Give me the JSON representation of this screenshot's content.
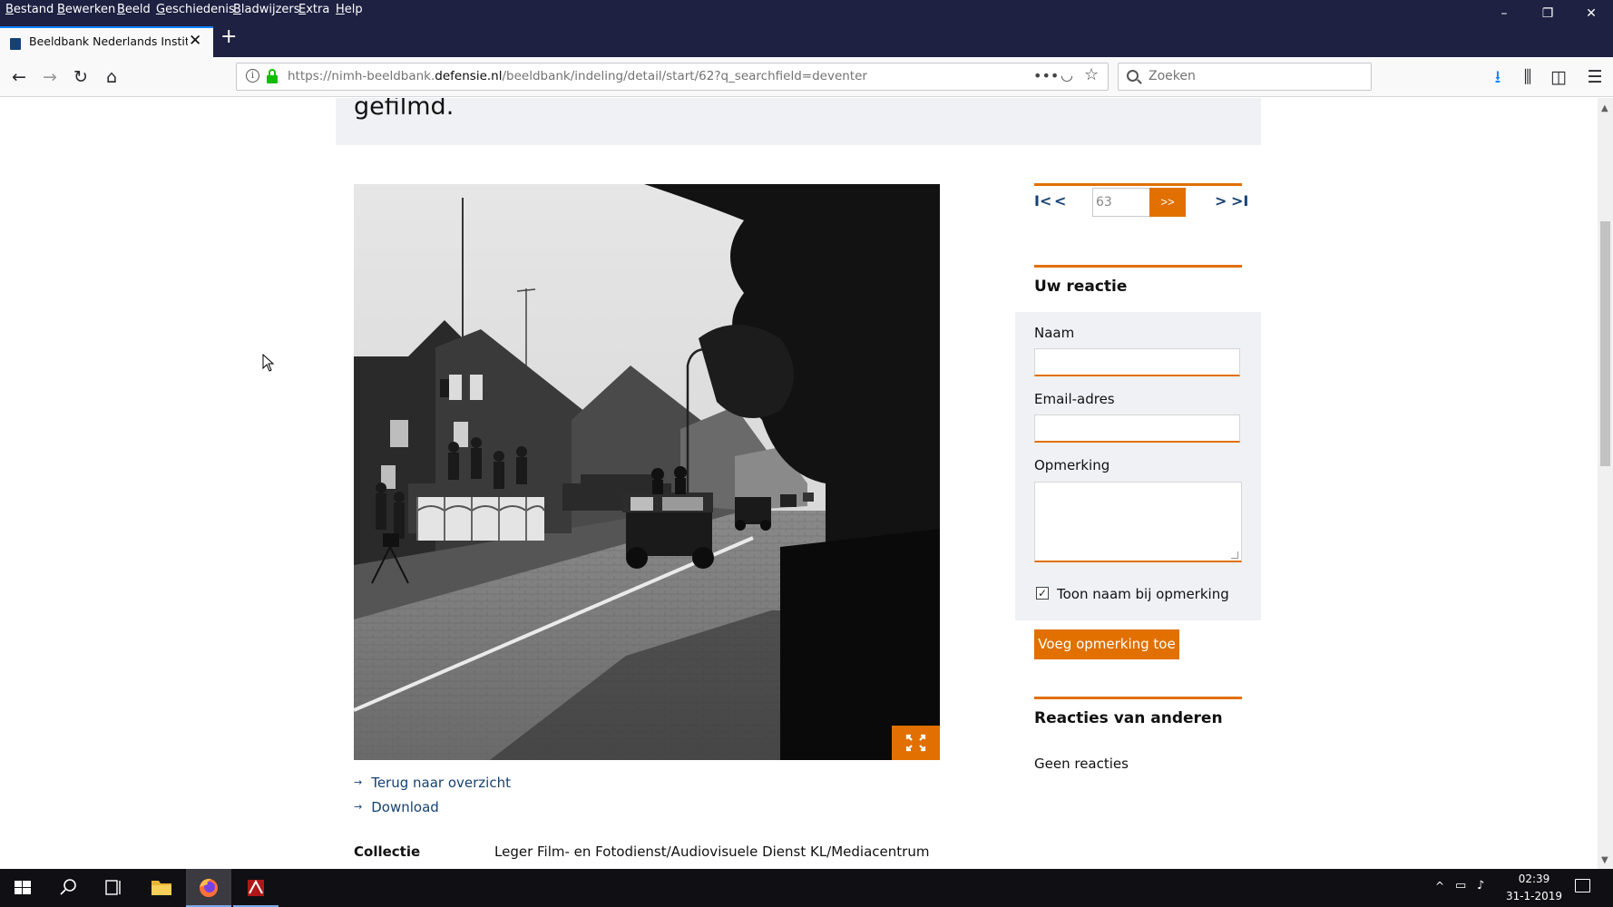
{
  "menubar": {
    "items": [
      "Bestand",
      "Bewerken",
      "Beeld",
      "Geschiedenis",
      "Bladwijzers",
      "Extra",
      "Help"
    ]
  },
  "window_controls": {
    "minimize": "–",
    "restore": "❐",
    "close": "✕"
  },
  "tab": {
    "title": "Beeldbank Nederlands Instituut",
    "close": "✕",
    "new_tab": "+"
  },
  "nav": {
    "back": "←",
    "forward": "→",
    "reload": "↻",
    "home": "⌂",
    "url_prefix": "https://nimh-beeldbank.",
    "url_domain": "defensie.nl",
    "url_path": "/beeldbank/indeling/detail/start/62?q_searchfield=deventer",
    "more": "•••",
    "pocket": "◡",
    "bookmark": "☆",
    "search_placeholder": "Zoeken",
    "downloads": "⭳",
    "library": "⫼",
    "sidebar": "◫",
    "menu": "☰"
  },
  "page": {
    "banner_text": "gefilmd.",
    "links": [
      "Terug naar overzicht",
      "Download"
    ],
    "link_arrow": "→",
    "collection_label": "Collectie",
    "collection_value": "Leger Film- en Fotodienst/Audiovisuele Dienst KL/Mediacentrum"
  },
  "pager": {
    "first": "I<",
    "prev": "<",
    "page_value": "63",
    "go": ">>",
    "next": ">",
    "last": ">I"
  },
  "reaction_form": {
    "heading": "Uw reactie",
    "name_label": "Naam",
    "email_label": "Email-adres",
    "remark_label": "Opmerking",
    "show_name_checked": true,
    "check_mark": "✓",
    "show_name_label": "Toon naam bij opmerking",
    "submit_label": "Voeg opmerking toe"
  },
  "others": {
    "heading": "Reacties van anderen",
    "empty": "Geen reacties"
  },
  "scrollbar": {
    "up": "▲",
    "down": "▼"
  },
  "taskbar": {
    "tray_chevron": "^",
    "network": "▭",
    "volume": "♪",
    "time": "02:39",
    "date": "31-1-2019"
  },
  "colors": {
    "accent_orange": "#e17000",
    "link_blue": "#154273",
    "chrome_dark": "#1e2142",
    "panel_bg": "#eff1f5"
  }
}
